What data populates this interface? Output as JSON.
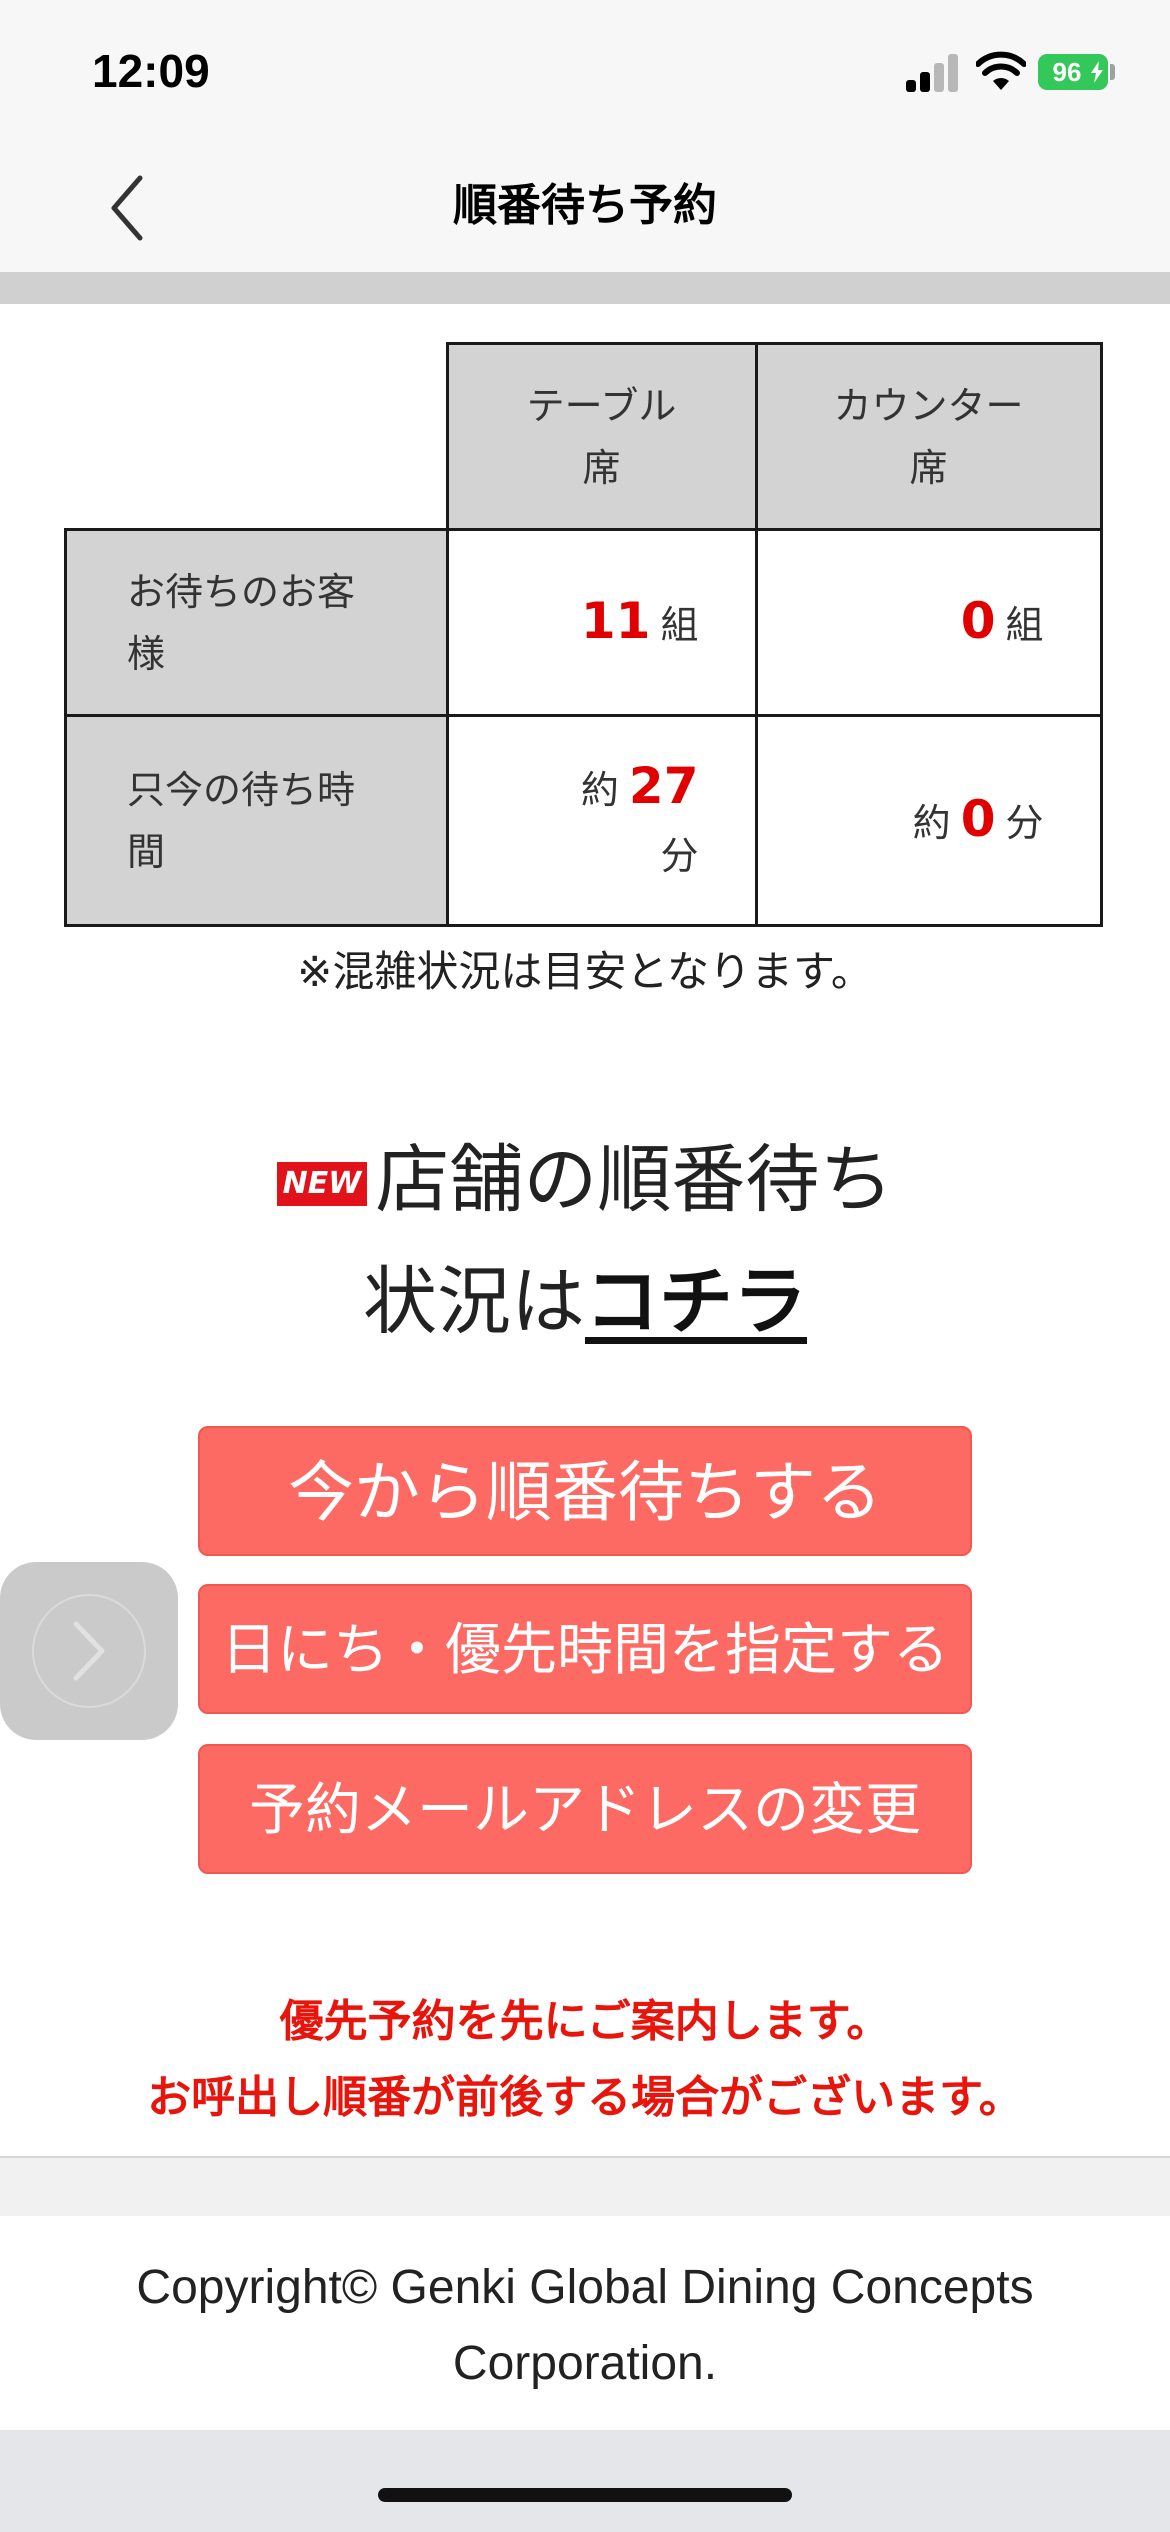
{
  "status_bar": {
    "time": "12:09",
    "battery": "96"
  },
  "nav": {
    "title": "順番待ち予約",
    "back_icon": "chevron-left-icon"
  },
  "wait_table": {
    "col_table_1": "テーブル",
    "col_table_2": "席",
    "col_counter_1": "カウンター",
    "col_counter_2": "席",
    "row_guests_1": "お待ちのお客",
    "row_guests_2": "様",
    "row_time_1": "只今の待ち時",
    "row_time_2": "間",
    "table_groups": "11",
    "counter_groups": "0",
    "group_unit": "組",
    "approx": "約",
    "table_minutes": "27",
    "counter_minutes": "0",
    "minute_unit": "分"
  },
  "note": "※混雑状況は目安となります。",
  "promo": {
    "badge": "NEW",
    "line1": "店舗の順番待ち",
    "line2_prefix": "状況は",
    "link": "コチラ"
  },
  "buttons": {
    "wait_now": "今から順番待ちする",
    "specify": "日にち・優先時間を指定する",
    "change_email": "予約メールアドレスの変更"
  },
  "floating_button_icon": "chevron-right-icon",
  "priority_notice": {
    "line1": "優先予約を先にご案内します。",
    "line2": "お呼出し順番が前後する場合がございます。"
  },
  "footer": {
    "line1": "Copyright© Genki Global Dining Concepts",
    "line2": "Corporation."
  },
  "colors": {
    "accent_red": "#e00000",
    "button_bg": "#fd6a63",
    "header_gray": "#d3d3d3"
  }
}
